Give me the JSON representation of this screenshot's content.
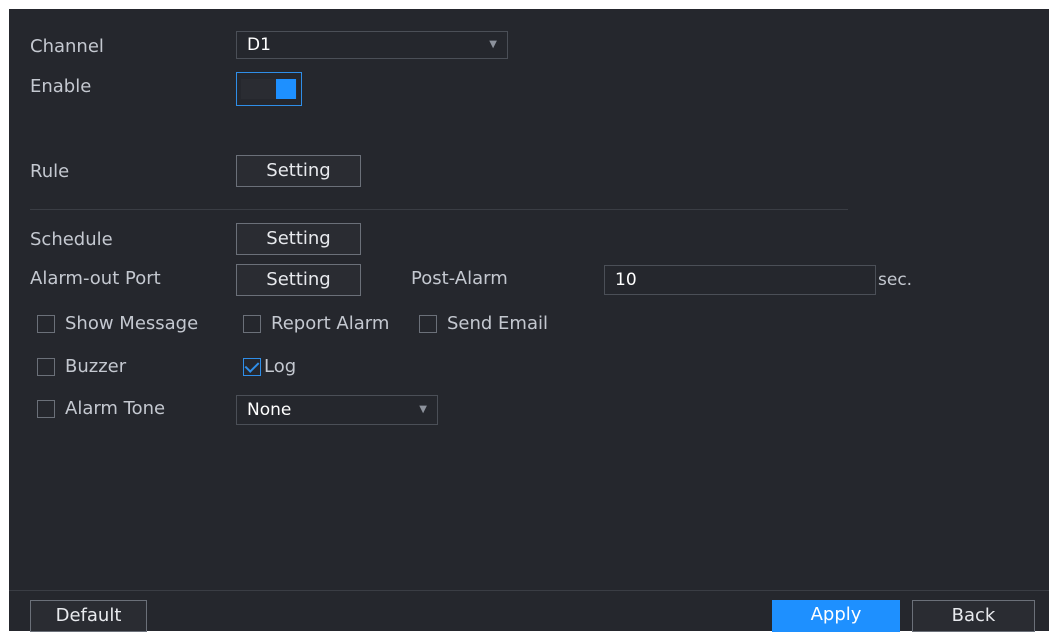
{
  "fields": {
    "channel": {
      "label": "Channel",
      "value": "D1"
    },
    "enable": {
      "label": "Enable",
      "on": true
    },
    "rule": {
      "label": "Rule",
      "button": "Setting"
    },
    "schedule": {
      "label": "Schedule",
      "button": "Setting"
    },
    "alarm_out": {
      "label": "Alarm-out Port",
      "button": "Setting"
    },
    "post_alarm": {
      "label": "Post-Alarm",
      "value": "10",
      "unit": "sec."
    },
    "alarm_tone": {
      "label": "Alarm Tone",
      "value": "None"
    }
  },
  "checkboxes": [
    {
      "label": "Show Message",
      "checked": false
    },
    {
      "label": "Report Alarm",
      "checked": false
    },
    {
      "label": "Send Email",
      "checked": false
    },
    {
      "label": "Buzzer",
      "checked": false
    },
    {
      "label": "Log",
      "checked": true
    },
    {
      "label": "Alarm Tone",
      "checked": false
    }
  ],
  "footer": {
    "default": "Default",
    "apply": "Apply",
    "back": "Back"
  },
  "colors": {
    "accent": "#1e90ff",
    "background": "#25272d",
    "checkmark": "#2f8ee8"
  }
}
